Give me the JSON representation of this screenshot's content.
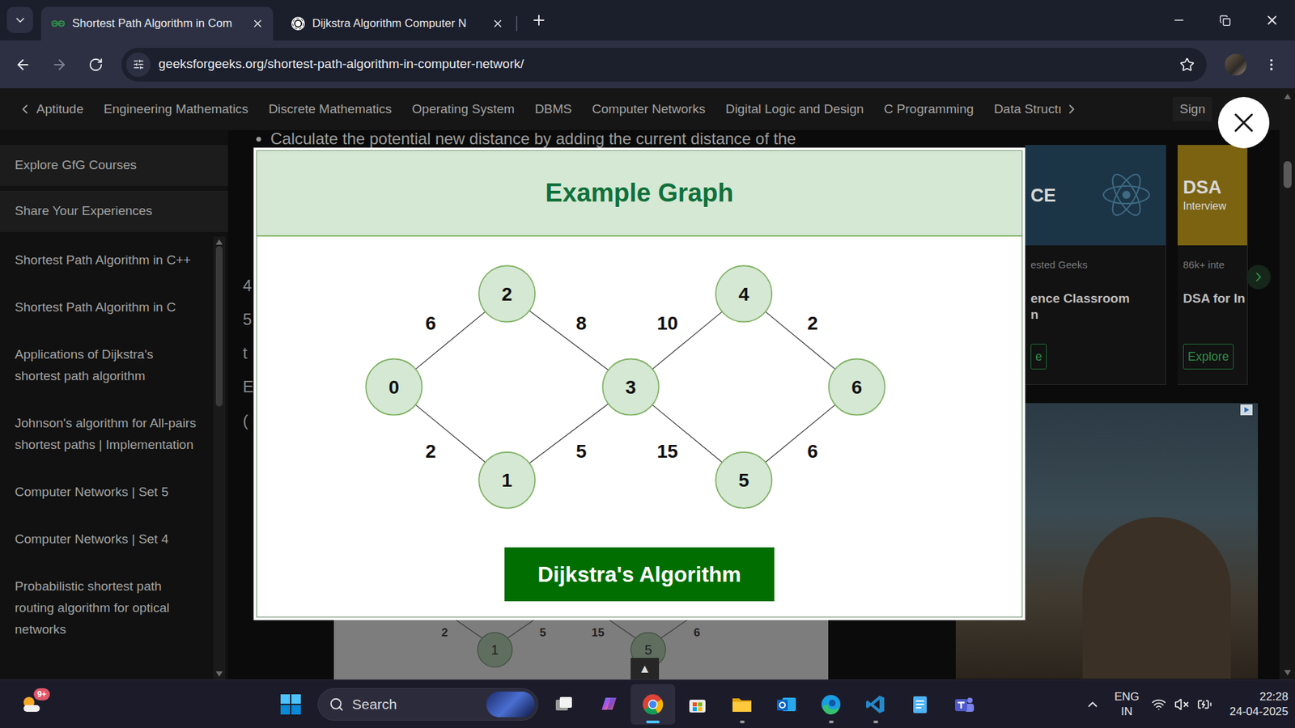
{
  "browser": {
    "tabs": [
      {
        "label": "Shortest Path Algorithm in Com",
        "selected": true,
        "kind": "gfg"
      },
      {
        "label": "Dijkstra Algorithm Computer N",
        "selected": false,
        "kind": "chatgpt"
      }
    ],
    "address": "geeksforgeeks.org/shortest-path-algorithm-in-computer-network/",
    "bookmarked": false
  },
  "nav": {
    "items": [
      "Aptitude",
      "Engineering Mathematics",
      "Discrete Mathematics",
      "Operating System",
      "DBMS",
      "Computer Networks",
      "Digital Logic and Design",
      "C Programming",
      "Data Structı"
    ],
    "sign_in": "Sign"
  },
  "sidebar": {
    "buttons": [
      "Explore GfG Courses",
      "Share Your Experiences"
    ],
    "items": [
      "Shortest Path Algorithm in C++",
      "Shortest Path Algorithm in C",
      "Applications of Dijkstra's shortest path algorithm",
      "Johnson's algorithm for All-pairs shortest paths | Implementation",
      "Computer Networks | Set 5",
      "Computer Networks | Set 4",
      "Probabilistic shortest path routing algorithm for optical networks"
    ]
  },
  "content": {
    "bullet": "Calculate the potential new distance by adding the current distance of the",
    "fragments": [
      "4",
      "5",
      "t",
      "E",
      "("
    ]
  },
  "modal": {
    "title": "Example Graph",
    "nodes": [
      "0",
      "1",
      "2",
      "3",
      "4",
      "5",
      "6"
    ],
    "edges": [
      {
        "from": "0",
        "to": "2",
        "weight": "6"
      },
      {
        "from": "2",
        "to": "3",
        "weight": "8"
      },
      {
        "from": "3",
        "to": "4",
        "weight": "10"
      },
      {
        "from": "4",
        "to": "6",
        "weight": "2"
      },
      {
        "from": "0",
        "to": "1",
        "weight": "2"
      },
      {
        "from": "1",
        "to": "3",
        "weight": "5"
      },
      {
        "from": "3",
        "to": "5",
        "weight": "15"
      },
      {
        "from": "5",
        "to": "6",
        "weight": "6"
      }
    ],
    "button": "Dijkstra's Algorithm"
  },
  "background_figure": {
    "edge_labels": [
      "2",
      "5",
      "15",
      "6"
    ],
    "nodes": [
      "1",
      "5"
    ]
  },
  "scroll_top": "▲",
  "ads": {
    "cards": [
      {
        "image_text": "CE",
        "meta": "ested Geeks",
        "title": [
          "ence Classroom",
          "n"
        ],
        "button": "e",
        "color": "#1c3546"
      },
      {
        "image_text": "DSA",
        "image_subtext": "Interview",
        "meta": "86k+ inte",
        "title": [
          "DSA for In"
        ],
        "button": "Explore",
        "color": "#7b6312"
      }
    ]
  },
  "taskbar": {
    "notification_badge": "9+",
    "search_placeholder": "Search",
    "apps": [
      {
        "kind": "taskview",
        "running": false,
        "active": false
      },
      {
        "kind": "copilot",
        "running": false,
        "active": false
      },
      {
        "kind": "chrome",
        "running": true,
        "active": true
      },
      {
        "kind": "store",
        "running": false,
        "active": false
      },
      {
        "kind": "explorer",
        "running": true,
        "active": false
      },
      {
        "kind": "outlook",
        "running": false,
        "active": false
      },
      {
        "kind": "edge",
        "running": true,
        "active": false
      },
      {
        "kind": "vscode",
        "running": true,
        "active": false
      },
      {
        "kind": "notepad",
        "running": false,
        "active": false
      },
      {
        "kind": "teams",
        "running": false,
        "active": false
      }
    ],
    "language": [
      "ENG",
      "IN"
    ],
    "volume_muted": true,
    "charging": true,
    "time": "22:28",
    "date": "24-04-2025"
  }
}
